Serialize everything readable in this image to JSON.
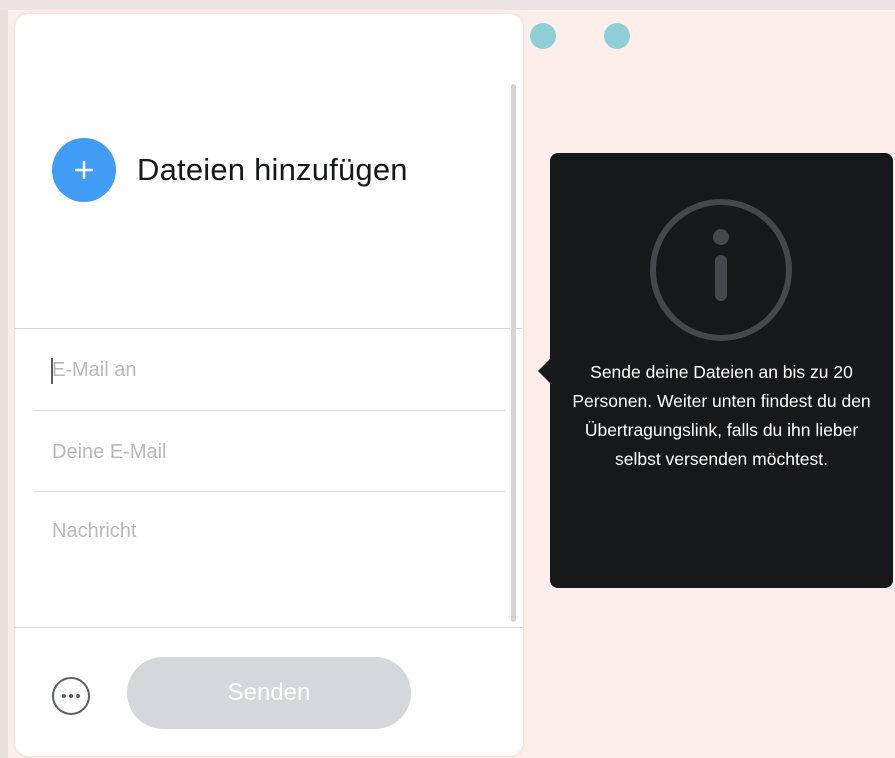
{
  "upload": {
    "add_files_label": "Dateien hinzufügen"
  },
  "form": {
    "email_to_placeholder": "E-Mail an",
    "your_email_placeholder": "Deine E-Mail",
    "message_placeholder": "Nachricht"
  },
  "footer": {
    "send_label": "Senden"
  },
  "tooltip": {
    "text": "Sende deine Dateien an bis zu 20 Personen. Weiter unten findest du den Übertragungslink, falls du ihn lieber selbst versenden möchtest."
  },
  "icons": {
    "add": "plus-icon",
    "more": "more-options-icon",
    "info": "info-icon"
  },
  "colors": {
    "accent": "#409cf4",
    "tooltip_bg": "#17181a",
    "page_bg": "#fdeeeb",
    "dots": "#8fd0d6",
    "disabled_button": "#d5d7da"
  }
}
